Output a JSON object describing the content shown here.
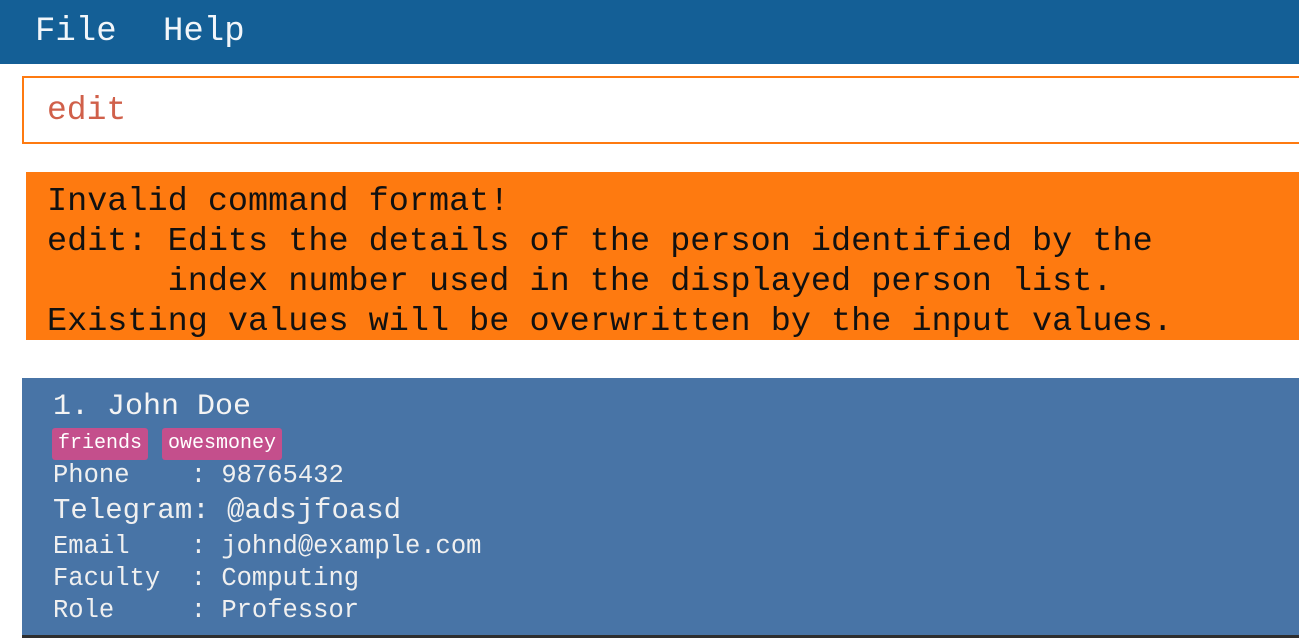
{
  "menu": {
    "items": [
      "File",
      "Help"
    ]
  },
  "command_box": {
    "value": "edit"
  },
  "result_display": {
    "text": "Invalid command format!\nedit: Edits the details of the person identified by the\n      index number used in the displayed person list.\nExisting values will be overwritten by the input values."
  },
  "person_list": [
    {
      "index_name": "1. John Doe",
      "tags": [
        "friends",
        "owesmoney"
      ],
      "phone": "Phone    : 98765432",
      "telegram": "Telegram: @adsjfoasd",
      "email": "Email    : johnd@example.com",
      "faculty": "Faculty  : Computing",
      "role": "Role     : Professor"
    }
  ],
  "colors": {
    "menu_bar": "#145f96",
    "accent": "#fe7a10",
    "card": "#4874a6",
    "tag": "#c44f8c"
  }
}
